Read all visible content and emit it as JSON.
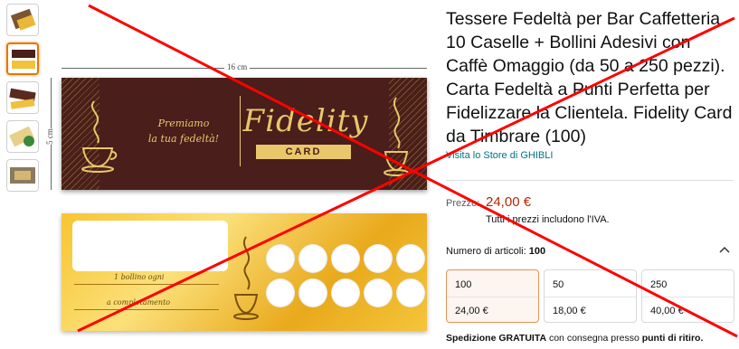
{
  "product": {
    "title": "Tessere Fedeltà per Bar Caffetteria 10 Caselle + Bollini Adesivi con Caffè Omaggio (da 50 a 250 pezzi). Carta Fedeltà a Punti Perfetta per Fidelizzare la Clientela. Fidelity Card da Timbrare (100)",
    "store_link": "Visita lo Store di GHIBLI"
  },
  "price": {
    "label": "Prezzo:",
    "value": "24,00 €",
    "vat_note": "Tutti i prezzi includono l'IVA."
  },
  "quantity": {
    "label": "Numero di articoli:",
    "selected": "100",
    "options": [
      {
        "count": "100",
        "price": "24,00 €"
      },
      {
        "count": "50",
        "price": "18,00 €"
      },
      {
        "count": "250",
        "price": "40,00 €"
      }
    ]
  },
  "shipping": {
    "prefix": "Spedizione",
    "free": "GRATUITA",
    "middle": "con consegna presso",
    "pickup": "punti di ritiro."
  },
  "image": {
    "width_label": "16 cm",
    "height_label": "5 cm",
    "card_front": {
      "premiamo_line1": "Premiamo",
      "premiamo_line2": "la tua fedeltà!",
      "logo_word": "Fidelity",
      "logo_sub": "CARD"
    },
    "card_back": {
      "line1": "1 bollino ogni",
      "line2": "a completamento",
      "stamp_count": 10
    }
  },
  "thumbnails": [
    "thumb-1",
    "thumb-2",
    "thumb-3",
    "thumb-4",
    "thumb-5"
  ],
  "colors": {
    "link": "#007185",
    "price": "#b12704",
    "card_brown": "#4a1e1a",
    "card_gold": "#e9c76b",
    "selected_border": "#e59355",
    "overlay_red": "#ff0000"
  }
}
